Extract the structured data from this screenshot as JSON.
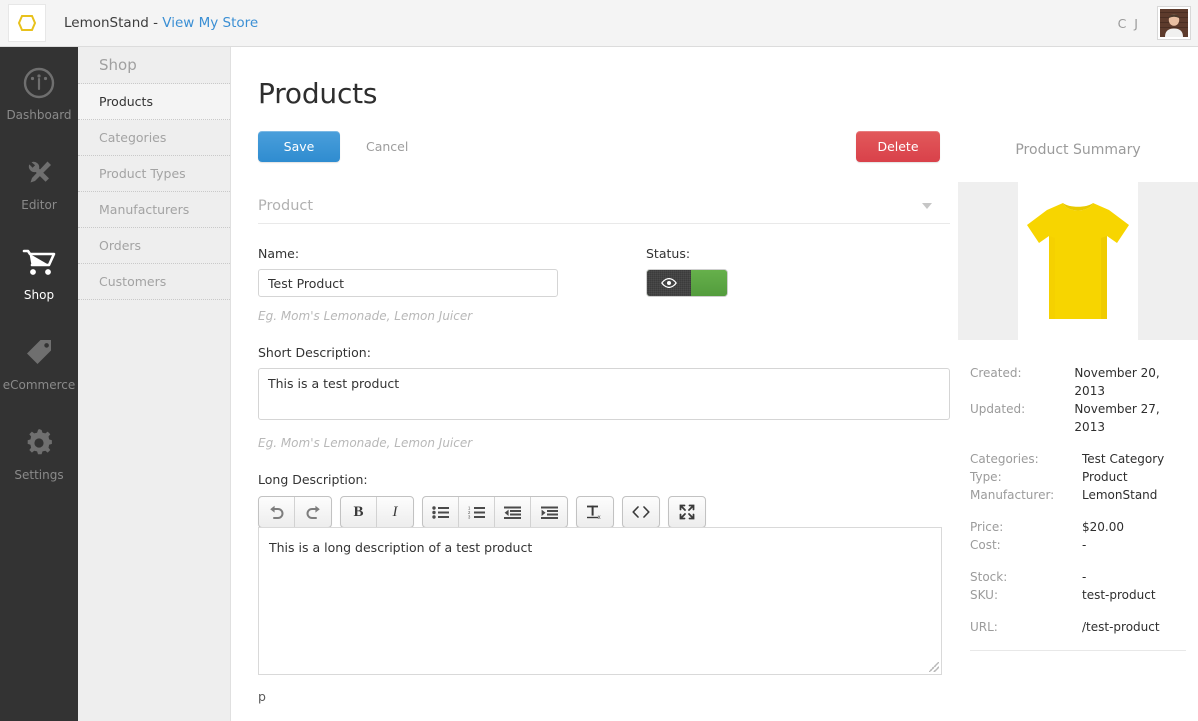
{
  "topbar": {
    "logo_icon": "lemonstand-logo-icon",
    "brand": "LemonStand - ",
    "store_link": "View My Store",
    "user_initials": "C J",
    "avatar_icon": "user-avatar"
  },
  "rail": {
    "items": [
      {
        "label": "Dashboard",
        "icon": "gauge-icon",
        "active": false
      },
      {
        "label": "Editor",
        "icon": "wrench-pencil-icon",
        "active": false
      },
      {
        "label": "Shop",
        "icon": "shopping-cart-icon",
        "active": true
      },
      {
        "label": "eCommerce",
        "icon": "price-tag-icon",
        "active": false
      },
      {
        "label": "Settings",
        "icon": "gear-icon",
        "active": false
      }
    ]
  },
  "subnav": {
    "heading": "Shop",
    "items": [
      {
        "label": "Products",
        "active": true
      },
      {
        "label": "Categories",
        "active": false
      },
      {
        "label": "Product Types",
        "active": false
      },
      {
        "label": "Manufacturers",
        "active": false
      },
      {
        "label": "Orders",
        "active": false
      },
      {
        "label": "Customers",
        "active": false
      }
    ]
  },
  "main": {
    "page_title": "Products",
    "save_label": "Save",
    "cancel_label": "Cancel",
    "delete_label": "Delete",
    "section_label": "Product",
    "name": {
      "label": "Name:",
      "value": "Test Product",
      "placeholder": "",
      "helper": "Eg. Mom's Lemonade, Lemon Juicer"
    },
    "status": {
      "label": "Status:",
      "state": "on",
      "icon": "eye-icon"
    },
    "short_description": {
      "label": "Short Description:",
      "value": "This is a test product",
      "placeholder": "",
      "helper": "Eg. Mom's Lemonade, Lemon Juicer"
    },
    "long_description": {
      "label": "Long Description:",
      "value": "This is a long description of a test product",
      "path": "p"
    },
    "toolbar": [
      {
        "name": "undo-icon",
        "title": "Undo"
      },
      {
        "name": "redo-icon",
        "title": "Redo"
      },
      {
        "name": "bold-icon",
        "title": "Bold"
      },
      {
        "name": "italic-icon",
        "title": "Italic"
      },
      {
        "name": "bullet-list-icon",
        "title": "Unordered List"
      },
      {
        "name": "numbered-list-icon",
        "title": "Ordered List"
      },
      {
        "name": "outdent-icon",
        "title": "Outdent"
      },
      {
        "name": "indent-icon",
        "title": "Indent"
      },
      {
        "name": "clear-formatting-icon",
        "title": "Remove Format"
      },
      {
        "name": "code-view-icon",
        "title": "Code View"
      },
      {
        "name": "fullscreen-icon",
        "title": "Fullscreen"
      }
    ]
  },
  "summary": {
    "title": "Product Summary",
    "image_icon": "yellow-tshirt-image",
    "rows": [
      {
        "key": "Created:",
        "value": "November 20, 2013"
      },
      {
        "key": "Updated:",
        "value": "November 27, 2013"
      },
      {
        "key": "Categories:",
        "value": "Test Category"
      },
      {
        "key": "Type:",
        "value": "Product"
      },
      {
        "key": "Manufacturer:",
        "value": "LemonStand"
      },
      {
        "key": "Price:",
        "value": "$20.00"
      },
      {
        "key": "Cost:",
        "value": "-"
      },
      {
        "key": "Stock:",
        "value": "-"
      },
      {
        "key": "SKU:",
        "value": "test-product"
      },
      {
        "key": "URL:",
        "value": "/test-product"
      }
    ]
  },
  "colors": {
    "accent_blue": "#3b8fd4",
    "save_blue": "#2f8cd0",
    "delete_red": "#d9414a",
    "status_green": "#5aa441",
    "rail_dark": "#333333",
    "subnav_bg": "#eeeeee",
    "tshirt_yellow": "#f7d500"
  }
}
